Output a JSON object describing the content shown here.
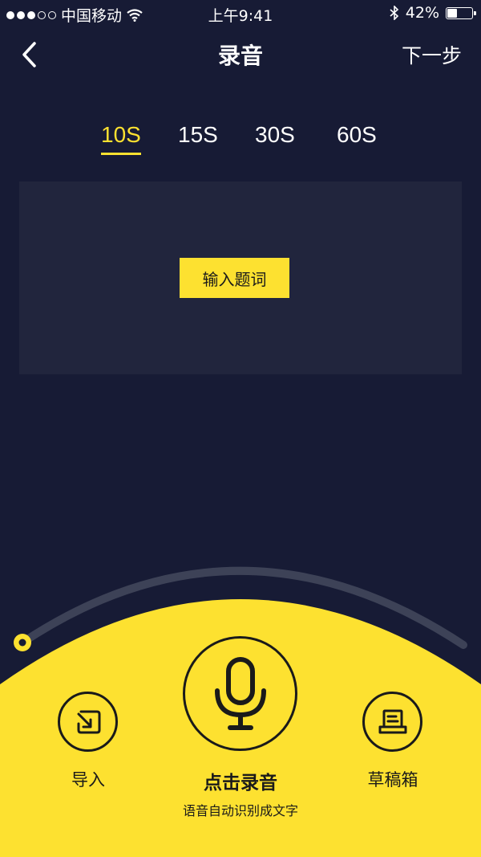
{
  "status": {
    "carrier": "中国移动",
    "time": "上午9:41",
    "battery_percent": "42%",
    "battery_level": 0.42
  },
  "nav": {
    "title": "录音",
    "next_label": "下一步",
    "back_icon": "chevron-left-icon"
  },
  "duration_tabs": [
    {
      "label": "10S",
      "active": true
    },
    {
      "label": "15S",
      "active": false
    },
    {
      "label": "30S",
      "active": false
    },
    {
      "label": "60S",
      "active": false
    }
  ],
  "prompt": {
    "button_label": "输入题词"
  },
  "actions": {
    "import_label": "导入",
    "import_icon": "import-arrow-icon",
    "record_label": "点击录音",
    "record_sub": "语音自动识别成文字",
    "record_icon": "microphone-icon",
    "draft_label": "草稿箱",
    "draft_icon": "draft-box-icon"
  },
  "progress": 0.0,
  "colors": {
    "background": "#171b35",
    "panel": "#21253d",
    "accent": "#fde130",
    "track": "#3d4257",
    "dark_text": "#1a1a1a"
  }
}
